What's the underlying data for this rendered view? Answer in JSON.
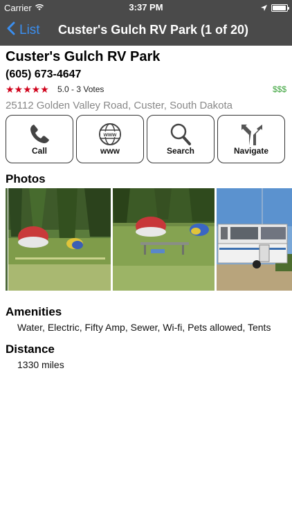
{
  "status_bar": {
    "carrier": "Carrier",
    "time": "3:37 PM",
    "battery_level": 0.95
  },
  "nav": {
    "back_label": "List",
    "title": "Custer's Gulch RV Park (1 of 20)"
  },
  "park": {
    "name": "Custer's Gulch RV Park",
    "phone": "(605) 673-4647",
    "stars": "★★★★★",
    "rating_text": "5.0 - 3 Votes",
    "price": "$$$",
    "address": "25112 Golden Valley Road, Custer, South Dakota"
  },
  "actions": [
    {
      "label": "Call",
      "icon": "phone-icon"
    },
    {
      "label": "www",
      "icon": "globe-icon"
    },
    {
      "label": "Search",
      "icon": "magnifier-icon"
    },
    {
      "label": "Navigate",
      "icon": "route-fork-icon"
    }
  ],
  "photos_title": "Photos",
  "photos": [
    {
      "subject": "tent-campsite-meadow"
    },
    {
      "subject": "tent-campsite-picnic-table"
    },
    {
      "subject": "pop-up-camper-trailer"
    }
  ],
  "amenities": {
    "title": "Amenities",
    "text": "Water, Electric, Fifty Amp, Sewer, Wi-fi, Pets allowed, Tents"
  },
  "distance": {
    "title": "Distance",
    "text": "1330 miles"
  },
  "colors": {
    "bar": "#4a4a4a",
    "link": "#3b8ff0",
    "stars": "#d0021b",
    "price": "#3aa33a",
    "address": "#888888"
  }
}
